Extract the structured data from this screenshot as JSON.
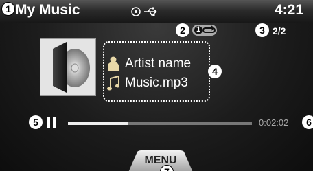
{
  "header": {
    "title": "My Music",
    "clock": "4:21",
    "callout_title": "1"
  },
  "status_icons": [
    "disc-icon",
    "usb-icon"
  ],
  "mode_indicator": {
    "repeat_label": "1",
    "callout": "2"
  },
  "track_counter": {
    "value": "2/2",
    "callout": "3"
  },
  "song_info": {
    "artist": "Artist name",
    "file": "Music.mp3",
    "callout": "4"
  },
  "playback": {
    "state": "paused",
    "elapsed": "0:02:02",
    "progress": 0.33,
    "callout_pause": "5",
    "callout_time": "6"
  },
  "menu": {
    "label": "MENU",
    "callout": "7"
  },
  "colors": {
    "background": "#1a1a1a",
    "accent": "#ffffff",
    "progress_track": "#777777"
  }
}
